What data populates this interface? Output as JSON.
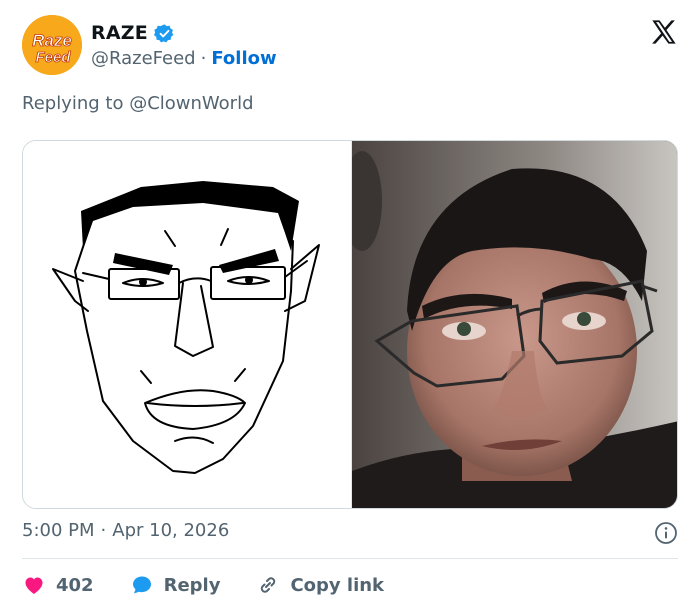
{
  "account": {
    "display_name": "RAZE",
    "handle": "@RazeFeed",
    "follow_label": "Follow",
    "separator": "·",
    "avatar_text_top": "Raze",
    "avatar_text_bottom": "Feed",
    "avatar_color": "#f7a81b"
  },
  "reply_context": {
    "prefix": "Replying to ",
    "mention": "@ClownWorld"
  },
  "timestamp": {
    "time": "5:00 PM",
    "separator": "·",
    "date": "Apr 10, 2026"
  },
  "actions": {
    "like_count": "402",
    "reply_label": "Reply",
    "copy_label": "Copy link"
  },
  "icons": {
    "brand": "x-logo-icon",
    "verified": "verified-badge-icon",
    "info": "info-icon",
    "like": "heart-icon",
    "reply": "reply-bubble-icon",
    "copy": "link-icon"
  },
  "colors": {
    "accent": "#1d9bf0",
    "follow": "#006fd6",
    "heart": "#f91880",
    "muted": "#536471"
  }
}
